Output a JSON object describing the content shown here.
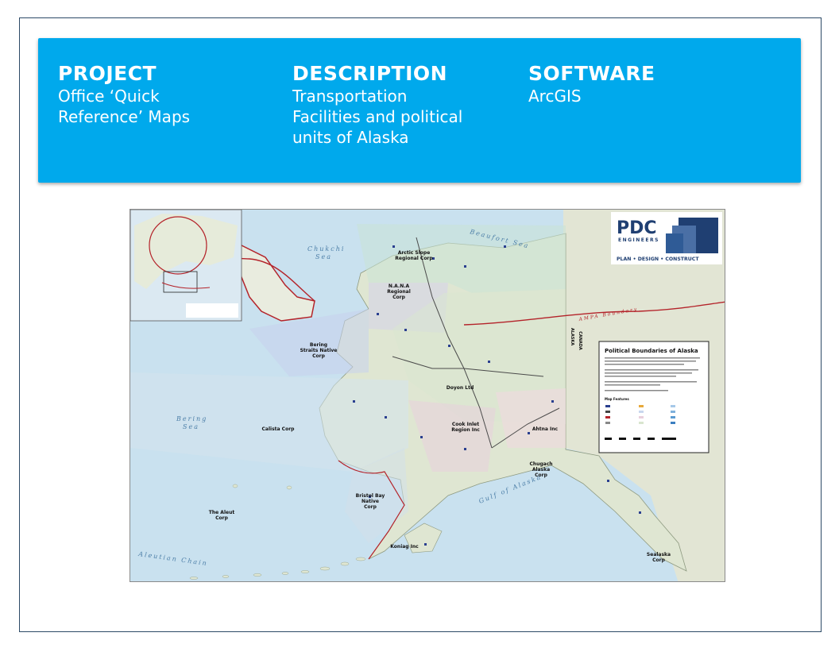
{
  "header": {
    "project_label": "PROJECT",
    "project_value": "Office ‘Quick\nReference’ Maps",
    "description_label": "DESCRIPTION",
    "description_value": "Transportation\nFacilities and political\nunits of Alaska",
    "software_label": "SOFTWARE",
    "software_value": "ArcGIS"
  },
  "map": {
    "logo_name": "PDC",
    "logo_sub": "ENGINEERS",
    "logo_tagline": "PLAN • DESIGN • CONSTRUCT",
    "legend_title": "Political Boundaries of Alaska",
    "legend_subtitle": "Map Features",
    "water_labels": {
      "beaufort": "Beaufort Sea",
      "chukchi": "Chukchi",
      "chukchi2": "Sea",
      "bering": "Bering",
      "bering2": "Sea",
      "gulf": "Gulf of Alaska",
      "aleutian": "Aleutian Chain"
    },
    "boundary_labels": {
      "ampa": "AMPA Boundary",
      "alaska": "ALASKA",
      "canada": "CANADA"
    },
    "regions": {
      "arctic_slope": "Arctic Slope",
      "arctic_slope2": "Regional Corp",
      "nana": "N.A.N.A",
      "nana2": "Regional",
      "nana3": "Corp",
      "bering_straits": "Bering",
      "bering_straits2": "Straits Native",
      "bering_straits3": "Corp",
      "doyon": "Doyon Ltd",
      "calista": "Calista Corp",
      "cook_inlet": "Cook Inlet",
      "cook_inlet2": "Region Inc",
      "ahtna": "Ahtna Inc",
      "chugach": "Chugach",
      "chugach2": "Alaska",
      "chugach3": "Corp",
      "bristol": "Bristol Bay",
      "bristol2": "Native",
      "bristol3": "Corp",
      "aleut": "The Aleut",
      "aleut2": "Corp",
      "koniag": "Koniag Inc",
      "sealaska": "Sealaska",
      "sealaska2": "Corp"
    },
    "colors": {
      "ocean": "#c9e1ef",
      "land": "#dfe6d2",
      "accent": "#00a9ec",
      "boundary": "#b4232a",
      "logo_navy": "#1f3f72"
    }
  }
}
